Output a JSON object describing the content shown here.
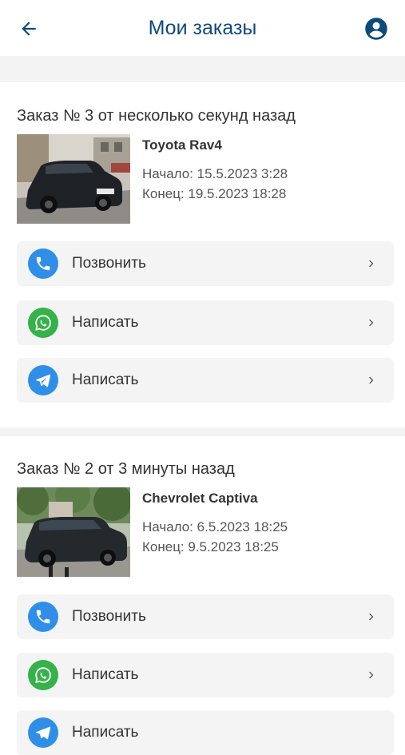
{
  "header": {
    "title": "Мои заказы",
    "back_icon": "arrow-left-icon",
    "account_icon": "account-circle-icon"
  },
  "colors": {
    "title": "#0e4a7a",
    "phone": "#2f8fe8",
    "whatsapp": "#35b24a",
    "telegram": "#2f8fe8",
    "action_bg": "#f4f4f4",
    "separator": "#f3f3f3"
  },
  "orders": [
    {
      "title": "Заказ № 3 от несколько секунд назад",
      "car": "Toyota Rav4",
      "start": "Начало: 15.5.2023 3:28",
      "end": "Конец: 19.5.2023 18:28",
      "actions": [
        {
          "label": "Позвонить",
          "icon": "phone-icon"
        },
        {
          "label": "Написать",
          "icon": "whatsapp-icon"
        },
        {
          "label": "Написать",
          "icon": "telegram-icon"
        }
      ]
    },
    {
      "title": "Заказ № 2 от 3 минуты назад",
      "car": "Chevrolet Captiva",
      "start": "Начало: 6.5.2023 18:25",
      "end": "Конец: 9.5.2023 18:25",
      "actions": [
        {
          "label": "Позвонить",
          "icon": "phone-icon"
        },
        {
          "label": "Написать",
          "icon": "whatsapp-icon"
        },
        {
          "label": "Написать",
          "icon": "telegram-icon"
        }
      ]
    }
  ]
}
